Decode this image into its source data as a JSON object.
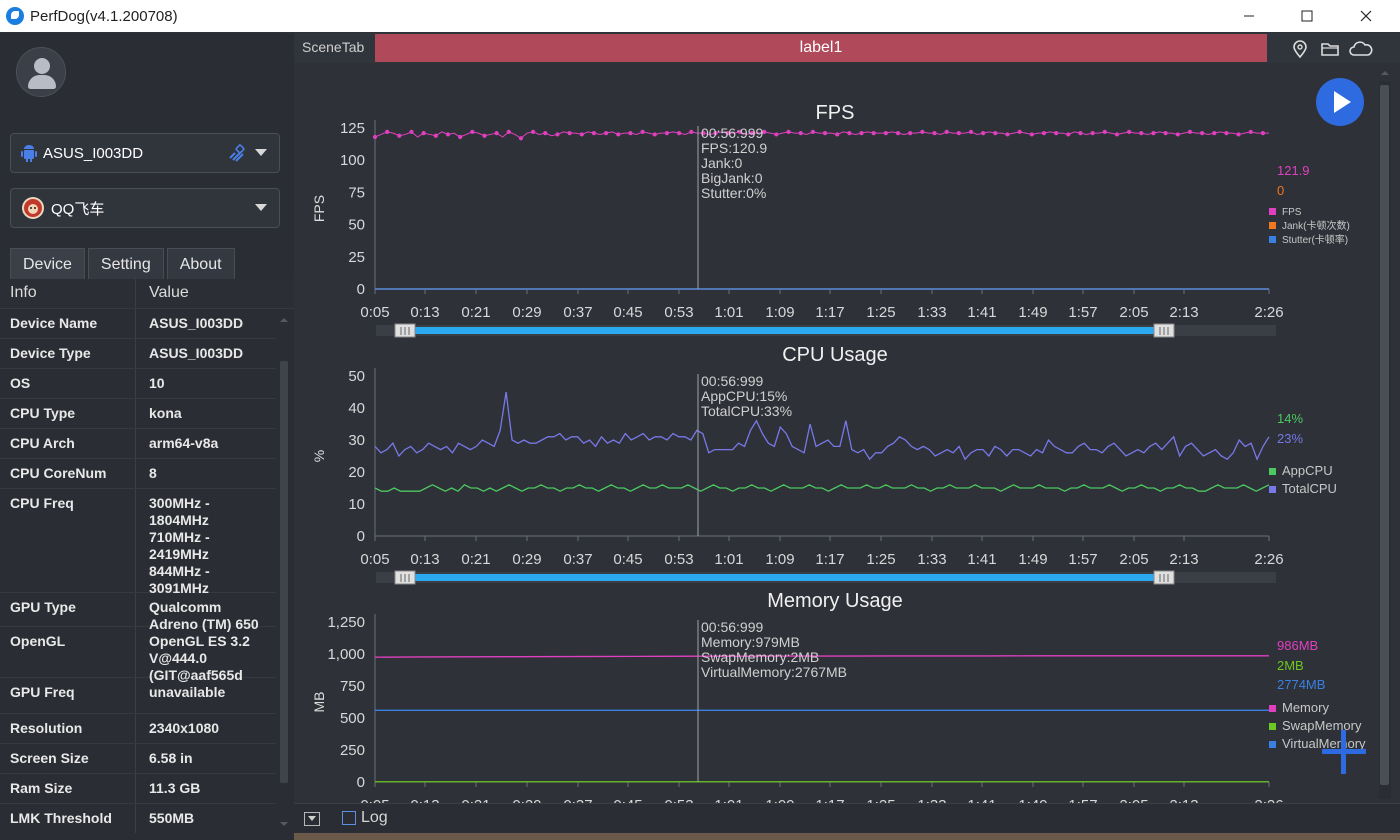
{
  "app": {
    "title": "PerfDog(v4.1.200708)"
  },
  "device_select": {
    "label": "ASUS_I003DD"
  },
  "app_select": {
    "label": "QQ飞车"
  },
  "tabs": [
    "Device",
    "Setting",
    "About"
  ],
  "info_table": {
    "headers": [
      "Info",
      "Value"
    ],
    "rows": [
      {
        "k": "Device Name",
        "v": "ASUS_I003DD"
      },
      {
        "k": "Device Type",
        "v": "ASUS_I003DD"
      },
      {
        "k": "OS",
        "v": "10"
      },
      {
        "k": "CPU Type",
        "v": "kona"
      },
      {
        "k": "CPU Arch",
        "v": "arm64-v8a"
      },
      {
        "k": "CPU CoreNum",
        "v": "8"
      },
      {
        "k": "CPU Freq",
        "v": "300MHz -\n1804MHz\n710MHz -\n2419MHz\n844MHz -\n3091MHz"
      },
      {
        "k": "GPU Type",
        "v": "Qualcomm\nAdreno (TM) 650"
      },
      {
        "k": "OpenGL",
        "v": "OpenGL ES 3.2\nV@444.0\n(GIT@aaf565d"
      },
      {
        "k": "GPU Freq",
        "v": "unavailable"
      },
      {
        "k": "Resolution",
        "v": "2340x1080"
      },
      {
        "k": "Screen Size",
        "v": "6.58 in"
      },
      {
        "k": "Ram Size",
        "v": "11.3 GB"
      },
      {
        "k": "LMK Threshold",
        "v": "550MB"
      }
    ]
  },
  "scene": {
    "tab": "SceneTab",
    "label": "label1"
  },
  "bottom": {
    "log": "Log"
  },
  "icons": [
    "location-icon",
    "folder-icon",
    "cloud-icon",
    "play-icon",
    "add-icon"
  ],
  "x_ticks": [
    "0:05",
    "0:13",
    "0:21",
    "0:29",
    "0:37",
    "0:45",
    "0:53",
    "1:01",
    "1:09",
    "1:17",
    "1:25",
    "1:33",
    "1:41",
    "1:49",
    "1:57",
    "2:05",
    "2:13",
    "2:26"
  ],
  "chart_data": [
    {
      "type": "line",
      "title": "FPS",
      "ylabel": "FPS",
      "ylim": [
        0,
        125
      ],
      "y_ticks": [
        "0",
        "25",
        "50",
        "75",
        "100",
        "125"
      ],
      "cursor_time": "00:56:999",
      "tooltip": [
        "00:56:999",
        "FPS:120.9",
        "Jank:0",
        "BigJank:0",
        "Stutter:0%"
      ],
      "series": [
        {
          "name": "FPS",
          "color": "#e040c0",
          "value_label": "121.9",
          "values": [
            118,
            120,
            122,
            121,
            119,
            120,
            122,
            118,
            121,
            120,
            119,
            122,
            120,
            121,
            118,
            120,
            122,
            121,
            119,
            120,
            121,
            118,
            122,
            120,
            117,
            121,
            122,
            120,
            121,
            119,
            120,
            122,
            121,
            121,
            120,
            122,
            121,
            120,
            121,
            122,
            120,
            121,
            121,
            120,
            122,
            121,
            120,
            121,
            121,
            122,
            121,
            120,
            122,
            121,
            121,
            120,
            121,
            122,
            121,
            121,
            122,
            120,
            121,
            121,
            122,
            121,
            120,
            121,
            122,
            121,
            121,
            120,
            122,
            121,
            121,
            121,
            120,
            122,
            121,
            120,
            121,
            122,
            121,
            121,
            121,
            122,
            121,
            120,
            121,
            121,
            122,
            121,
            121,
            120,
            122,
            121,
            121,
            121,
            122,
            120,
            121,
            122,
            121,
            121,
            120,
            121,
            122,
            121,
            120,
            121,
            121,
            122,
            121,
            121,
            120,
            122,
            121,
            120,
            121,
            121,
            122,
            121,
            120,
            121,
            122,
            121,
            121,
            120,
            121,
            122,
            121,
            121,
            120,
            121,
            122,
            121,
            121,
            120,
            121,
            122,
            121,
            121,
            120,
            121,
            122,
            121,
            121,
            121
          ]
        },
        {
          "name": "Jank(卡顿次数)",
          "color": "#f07820",
          "value_label": "0",
          "values": [
            0
          ]
        },
        {
          "name": "Stutter(卡顿率)",
          "color": "#3a80e0",
          "value_label": "",
          "values": [
            0
          ]
        }
      ]
    },
    {
      "type": "line",
      "title": "CPU Usage",
      "ylabel": "%",
      "ylim": [
        0,
        50
      ],
      "y_ticks": [
        "0",
        "10",
        "20",
        "30",
        "40",
        "50"
      ],
      "tooltip": [
        "00:56:999",
        "AppCPU:15%",
        "TotalCPU:33%"
      ],
      "series": [
        {
          "name": "AppCPU",
          "color": "#4cc860",
          "value_label": "14%",
          "values": [
            15,
            14,
            14,
            15,
            14,
            14,
            14,
            14,
            15,
            16,
            15,
            14,
            15,
            14,
            16,
            15,
            15,
            14,
            15,
            14,
            15,
            16,
            15,
            14,
            15,
            15,
            16,
            15,
            15,
            14,
            15,
            15,
            16,
            15,
            15,
            14,
            15,
            16,
            15,
            15,
            14,
            15,
            16,
            15,
            15,
            16,
            15,
            15,
            15,
            16,
            15,
            14,
            15,
            16,
            15,
            15,
            14,
            15,
            15,
            16,
            15,
            15,
            14,
            15,
            16,
            15,
            15,
            15,
            16,
            15,
            15,
            14,
            15,
            16,
            15,
            15,
            15,
            16,
            15,
            15,
            16,
            15,
            15,
            15,
            16,
            15,
            15,
            14,
            15,
            15,
            16,
            15,
            15,
            15,
            16,
            15,
            15,
            15,
            14,
            15,
            16,
            15,
            15,
            15,
            16,
            15,
            15,
            15,
            14,
            15,
            15,
            16,
            15,
            15,
            15,
            16,
            15,
            14,
            15,
            15,
            16,
            15,
            15,
            14,
            15,
            15,
            16,
            15,
            15,
            14,
            14,
            15,
            16,
            15,
            15,
            15,
            16,
            15,
            14,
            15,
            16
          ]
        },
        {
          "name": "TotalCPU",
          "color": "#7878e8",
          "value_label": "23%",
          "values": [
            28,
            26,
            27,
            29,
            25,
            27,
            28,
            26,
            27,
            29,
            28,
            27,
            28,
            26,
            29,
            28,
            27,
            28,
            30,
            29,
            28,
            33,
            45,
            30,
            29,
            30,
            29,
            29,
            30,
            31,
            31,
            32,
            30,
            31,
            31,
            29,
            30,
            28,
            31,
            29,
            30,
            29,
            32,
            30,
            31,
            32,
            30,
            31,
            31,
            30,
            32,
            31,
            31,
            30,
            33,
            32,
            26,
            27,
            27,
            27,
            27,
            29,
            28,
            33,
            36,
            32,
            29,
            28,
            34,
            32,
            28,
            27,
            26,
            35,
            28,
            29,
            30,
            28,
            28,
            36,
            27,
            26,
            27,
            24,
            26,
            26,
            28,
            29,
            31,
            30,
            28,
            27,
            28,
            27,
            25,
            26,
            27,
            26,
            28,
            24,
            26,
            27,
            27,
            25,
            28,
            27,
            25,
            27,
            27,
            26,
            25,
            27,
            26,
            30,
            28,
            27,
            26,
            26,
            28,
            29,
            27,
            27,
            26,
            28,
            29,
            27,
            25,
            26,
            27,
            26,
            28,
            29,
            27,
            29,
            31,
            25,
            28,
            29,
            27,
            25,
            26,
            27,
            25,
            24,
            26,
            30,
            28,
            29,
            24,
            28,
            31
          ]
        }
      ]
    },
    {
      "type": "line",
      "title": "Memory Usage",
      "ylabel": "MB",
      "ylim": [
        0,
        1250
      ],
      "y_ticks": [
        "0",
        "250",
        "500",
        "750",
        "1,000",
        "1,250"
      ],
      "tooltip": [
        "00:56:999",
        "Memory:979MB",
        "SwapMemory:2MB",
        "VirtualMemory:2767MB"
      ],
      "series": [
        {
          "name": "Memory",
          "color": "#e040c0",
          "value_label": "986MB",
          "values": [
            975,
            977,
            978,
            979,
            980,
            981,
            982,
            983,
            983,
            984,
            984,
            985,
            985,
            985,
            986,
            986,
            986,
            986,
            986,
            986
          ]
        },
        {
          "name": "SwapMemory",
          "color": "#6cc820",
          "value_label": "2MB",
          "values": [
            2,
            2,
            2,
            2,
            2,
            2,
            2,
            2,
            2,
            2,
            2,
            2,
            2,
            2,
            2,
            2,
            2,
            2,
            2,
            2
          ]
        },
        {
          "name": "VirtualMemory",
          "color": "#3a80e0",
          "value_label": "2774MB",
          "values": [
            560,
            560,
            560,
            560,
            560,
            560,
            560,
            560,
            560,
            560,
            560,
            560,
            560,
            560,
            560,
            560,
            560,
            560,
            560,
            560
          ]
        }
      ]
    }
  ]
}
